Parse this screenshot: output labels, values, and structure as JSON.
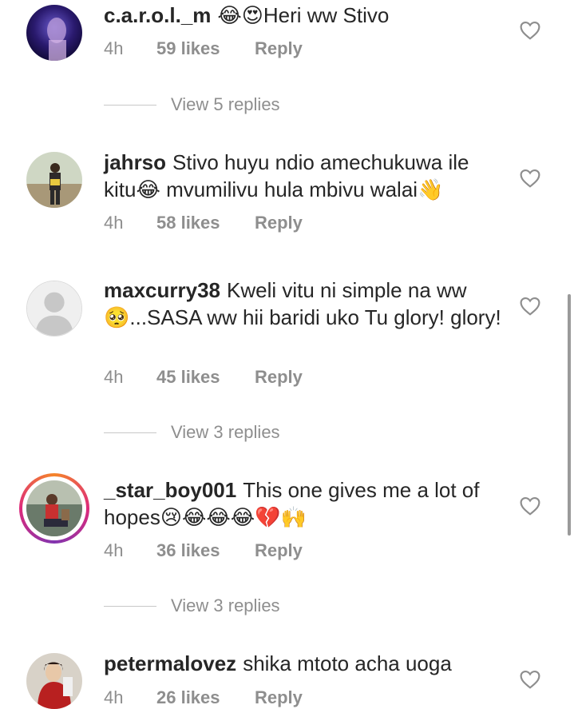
{
  "comments": [
    {
      "username": "c.a.r.o.l._m",
      "text_emoji_prefix": "😂😍",
      "text": "Heri ww Stivo",
      "time": "4h",
      "likes": "59 likes",
      "reply": "Reply",
      "view_replies": "View 5 replies"
    },
    {
      "username": "jahrso",
      "text": "Stivo huyu ndio amechukuwa ile kitu😂 mvumilivu hula mbivu walai👋",
      "time": "4h",
      "likes": "58 likes",
      "reply": "Reply"
    },
    {
      "username": "maxcurry38",
      "text": "Kweli vitu ni simple na ww 🥺...SASA ww hii baridi uko Tu glory! glory!",
      "time": "4h",
      "likes": "45 likes",
      "reply": "Reply",
      "view_replies": "View 3 replies"
    },
    {
      "username": "_star_boy001",
      "text": "This one gives me a lot of hopes😢😂😂😂💔🙌",
      "time": "4h",
      "likes": "36 likes",
      "reply": "Reply",
      "view_replies": "View 3 replies"
    },
    {
      "username": "petermalovez",
      "text": "shika mtoto acha  uoga",
      "time": "4h",
      "likes": "26 likes",
      "reply": "Reply"
    }
  ],
  "colors": {
    "text": "#262626",
    "secondary": "#8e8e8e",
    "story_ring": [
      "#f58529",
      "#dd2a7b",
      "#8134af"
    ]
  },
  "icons": {
    "like": "heart-outline-icon"
  }
}
